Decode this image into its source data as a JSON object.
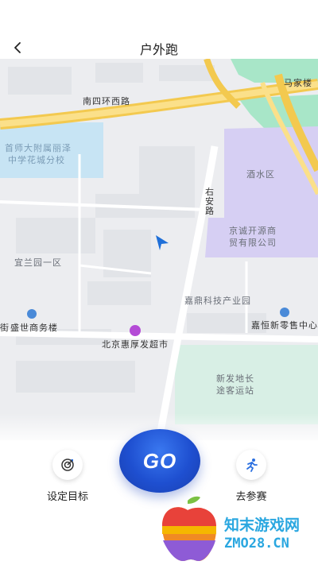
{
  "nav": {
    "title": "户外跑"
  },
  "map": {
    "labels": {
      "road_south_4th_ring": "南四环西路",
      "majialou": "马家楼",
      "school": "首师大附属丽泽",
      "school2": "中学花城分校",
      "jiushuiqu": "酒水区",
      "youanlu": "右安路",
      "jingcheng1": "京诚开源商",
      "jingcheng2": "贸有限公司",
      "yilanyuan": "宜兰园一区",
      "jiading": "嘉鼎科技产业园",
      "shengshi": "盛世商务楼",
      "jie": "街",
      "jiaheng": "嘉恒新零售中心",
      "beijing_market": "北京惠厚发超市",
      "xinfa1": "新发地长",
      "xinfa2": "途客运站"
    }
  },
  "controls": {
    "go_label": "GO",
    "set_goal_label": "设定目标",
    "join_race_label": "去参赛"
  },
  "watermark": {
    "line1": "知末游戏网",
    "line2": "ZMO28.CN"
  }
}
